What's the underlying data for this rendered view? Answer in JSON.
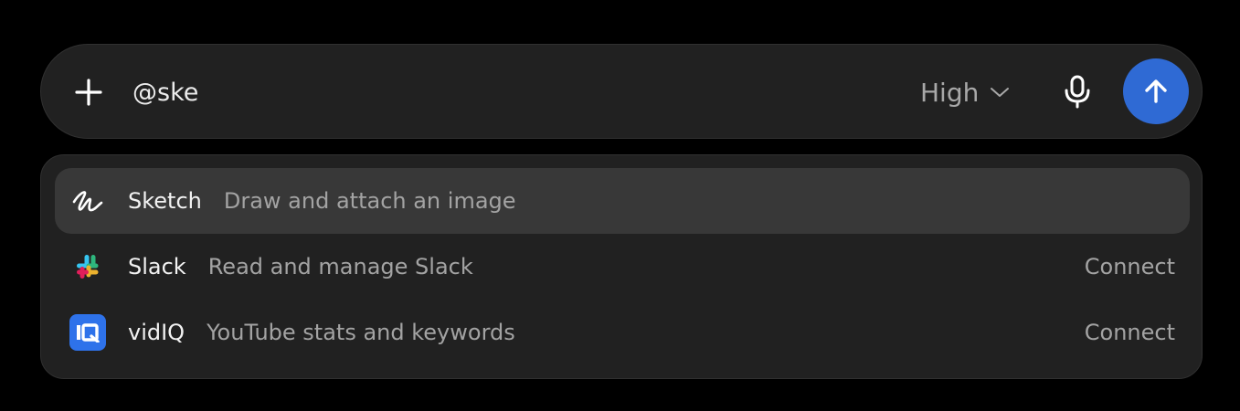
{
  "composer": {
    "input_value": "@ske",
    "effort_label": "High",
    "icons": {
      "attach": "plus-icon",
      "effort_toggle": "chevron-down-icon",
      "voice": "microphone-icon",
      "send": "arrow-up-icon"
    },
    "send_color": "#2f6ad4"
  },
  "mention_menu": {
    "selected_index": 0,
    "items": [
      {
        "name": "Sketch",
        "description": "Draw and attach an image",
        "icon": "sketch-scribble-icon",
        "action": ""
      },
      {
        "name": "Slack",
        "description": "Read and manage Slack",
        "icon": "slack-logo-icon",
        "action": "Connect"
      },
      {
        "name": "vidIQ",
        "description": "YouTube stats and keywords",
        "icon": "vidiq-logo-icon",
        "action": "Connect"
      }
    ]
  }
}
